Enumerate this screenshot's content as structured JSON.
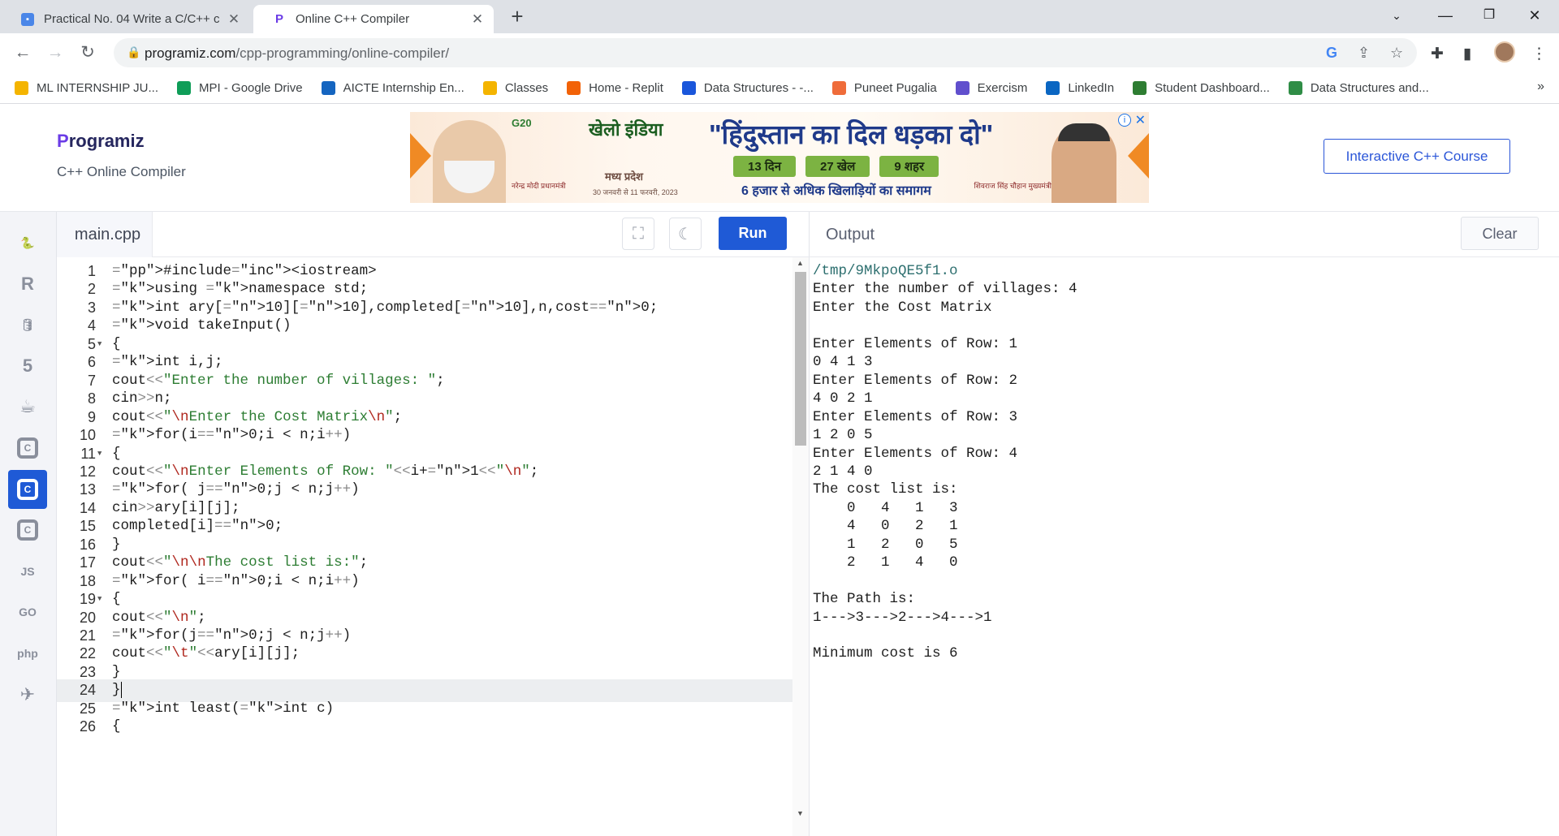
{
  "browser": {
    "tabs": [
      {
        "title": "Practical No. 04 Write a C/C++ c",
        "active": false,
        "icon": "doc-icon"
      },
      {
        "title": "Online C++ Compiler",
        "active": true,
        "icon": "programiz-icon"
      }
    ],
    "url_host": "programiz.com",
    "url_path": "/cpp-programming/online-compiler/",
    "bookmarks": [
      {
        "label": "ML INTERNSHIP JU...",
        "icon": "drive-icon",
        "color": "#f4b400"
      },
      {
        "label": "MPI - Google Drive",
        "icon": "drive-icon",
        "color": "#0f9d58"
      },
      {
        "label": "AICTE Internship En...",
        "icon": "aicte-icon",
        "color": "#1565c0"
      },
      {
        "label": "Classes",
        "icon": "classroom-icon",
        "color": "#f4b400"
      },
      {
        "label": "Home - Replit",
        "icon": "replit-icon",
        "color": "#f26207"
      },
      {
        "label": "Data Structures - -...",
        "icon": "scaler-icon",
        "color": "#1a56db"
      },
      {
        "label": "Puneet Pugalia",
        "icon": "profile-p-icon",
        "color": "#ef6c3a"
      },
      {
        "label": "Exercism",
        "icon": "exercism-icon",
        "color": "#604fcd"
      },
      {
        "label": "LinkedIn",
        "icon": "linkedin-icon",
        "color": "#0a66c2"
      },
      {
        "label": "Student Dashboard...",
        "icon": "dashboard-icon",
        "color": "#2e7d32"
      },
      {
        "label": "Data Structures and...",
        "icon": "gfg-icon",
        "color": "#2f8d46"
      }
    ]
  },
  "site": {
    "logo": "rogramiz",
    "logo_p": "P",
    "subtitle": "C++ Online Compiler",
    "course_button": "Interactive C++ Course",
    "ad": {
      "headline": "\"हिंदुस्तान का दिल धड़का दो\"",
      "pills": [
        "13 दिन",
        "27 खेल",
        "9 शहर"
      ],
      "tagline": "6 हजार से अधिक खिलाड़ियों का समागम",
      "brand": "खेलो इंडिया",
      "state": "मध्य प्रदेश",
      "dates": "30 जनवरी से 11 फरवरी, 2023",
      "g20": "G20",
      "caption_left": "नरेन्द्र मोदी प्रधानमंत्री",
      "caption_right": "शिवराज सिंह चौहान मुख्यमंत्री"
    }
  },
  "editor": {
    "filename": "main.cpp",
    "run_label": "Run",
    "current_line": 24,
    "lines": [
      "#include<iostream>",
      "using namespace std;",
      "int ary[10][10],completed[10],n,cost=0;",
      "void takeInput()",
      "{",
      "int i,j;",
      "cout<<\"Enter the number of villages: \";",
      "cin>>n;",
      "cout<<\"\\nEnter the Cost Matrix\\n\";",
      "for(i=0;i < n;i++)",
      "{",
      "cout<<\"\\nEnter Elements of Row: \"<<i+1<<\"\\n\";",
      "for( j=0;j < n;j++)",
      "cin>>ary[i][j];",
      "completed[i]=0;",
      "}",
      "cout<<\"\\n\\nThe cost list is:\";",
      "for( i=0;i < n;i++)",
      "{",
      "cout<<\"\\n\";",
      "for(j=0;j < n;j++)",
      "cout<<\"\\t\"<<ary[i][j];",
      "}",
      "}",
      "int least(int c)",
      "{"
    ]
  },
  "output": {
    "title": "Output",
    "clear_label": "Clear",
    "lines": [
      "/tmp/9MkpoQE5f1.o",
      "Enter the number of villages: 4",
      "Enter the Cost Matrix",
      "",
      "Enter Elements of Row: 1",
      "0 4 1 3",
      "Enter Elements of Row: 2",
      "4 0 2 1",
      "Enter Elements of Row: 3",
      "1 2 0 5",
      "Enter Elements of Row: 4",
      "2 1 4 0",
      "The cost list is:",
      "    0   4   1   3",
      "    4   0   2   1",
      "    1   2   0   5",
      "    2   1   4   0",
      "",
      "The Path is:",
      "1--->3--->2--->4--->1",
      "",
      "Minimum cost is 6"
    ]
  },
  "rail": [
    {
      "name": "python-icon",
      "glyph": "🐍",
      "active": false
    },
    {
      "name": "r-lang-icon",
      "glyph": "R",
      "active": false
    },
    {
      "name": "sql-database-icon",
      "glyph": "🛢",
      "active": false
    },
    {
      "name": "html5-icon",
      "glyph": "5",
      "active": false
    },
    {
      "name": "java-icon",
      "glyph": "☕",
      "active": false
    },
    {
      "name": "c-lang-icon",
      "glyph": "C",
      "active": false
    },
    {
      "name": "cpp-lang-icon",
      "glyph": "C",
      "active": true
    },
    {
      "name": "csharp-lang-icon",
      "glyph": "C",
      "active": false
    },
    {
      "name": "javascript-icon",
      "glyph": "JS",
      "active": false
    },
    {
      "name": "go-lang-icon",
      "glyph": "GO",
      "active": false
    },
    {
      "name": "php-icon",
      "glyph": "php",
      "active": false
    },
    {
      "name": "swift-icon",
      "glyph": "✈",
      "active": false
    }
  ],
  "colors": {
    "accent": "#1f5ad6",
    "brand": "#25265e"
  }
}
